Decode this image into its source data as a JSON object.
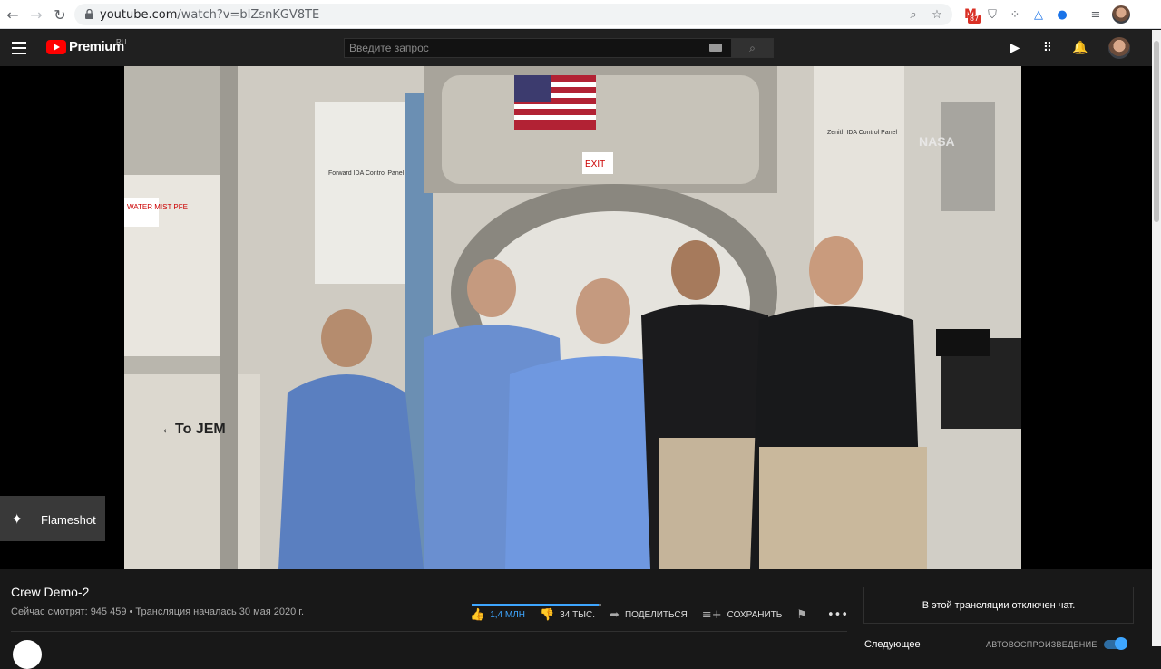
{
  "browser": {
    "url_host": "youtube.com",
    "url_path": "/watch?v=bIZsnKGV8TE",
    "gmail_badge": "87"
  },
  "masthead": {
    "brand": "Premium",
    "region": "RU",
    "search_placeholder": "Введите запрос"
  },
  "overlay": {
    "app_name": "Flameshot"
  },
  "video_scene": {
    "flag_sign": "EXIT",
    "left_sign": "←To JEM",
    "water_sign": "WATER MIST PFE",
    "zenith_sign": "Zenith IDA Control Panel",
    "forward_sign": "Forward IDA Control Panel",
    "nasa_logo": "NASA"
  },
  "video": {
    "title": "Crew Demo-2",
    "meta": "Сейчас смотрят: 945 459 • Трансляция началась 30 мая 2020 г.",
    "like_count": "1,4 МЛН",
    "dislike_count": "34 ТЫС.",
    "share_label": "ПОДЕЛИТЬСЯ",
    "save_label": "СОХРАНИТЬ",
    "like_ratio": 0.976
  },
  "chat": {
    "disabled_message": "В этой трансляции отключен чат."
  },
  "upnext": {
    "label": "Следующее",
    "autoplay_label": "АВТОВОСПРОИЗВЕДЕНИЕ",
    "autoplay_on": true
  }
}
